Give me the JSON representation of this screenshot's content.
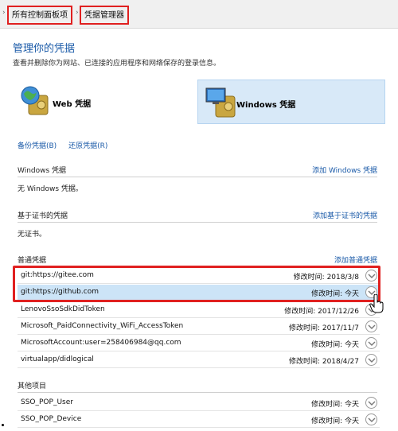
{
  "breadcrumb": {
    "items": [
      {
        "label": "所有控制面板项"
      },
      {
        "label": "凭据管理器"
      }
    ]
  },
  "page": {
    "title": "管理你的凭据",
    "description": "查看并删除你为网站、已连接的应用程序和网络保存的登录信息。"
  },
  "credential_types": [
    {
      "label": "Web 凭据",
      "icon": "globe-safe-icon",
      "selected": false
    },
    {
      "label": "Windows 凭据",
      "icon": "computer-safe-icon",
      "selected": true
    }
  ],
  "actions": {
    "backup": "备份凭据(B)",
    "restore": "还原凭据(R)"
  },
  "sections": {
    "windows": {
      "title": "Windows 凭据",
      "link": "添加 Windows 凭据",
      "empty": "无 Windows 凭据。"
    },
    "cert": {
      "title": "基于证书的凭据",
      "link": "添加基于证书的凭据",
      "empty": "无证书。"
    },
    "generic": {
      "title": "普通凭据",
      "link": "添加普通凭据",
      "items": [
        {
          "name": "git:https://gitee.com",
          "date": "修改时间:  2018/3/8"
        },
        {
          "name": "git:https://github.com",
          "date": "修改时间:  今天"
        },
        {
          "name": "LenovoSsoSdkDidToken",
          "date": "修改时间:  2017/12/26"
        },
        {
          "name": "Microsoft_PaidConnectivity_WiFi_AccessToken",
          "date": "修改时间:  2017/11/7"
        },
        {
          "name": "MicrosoftAccount:user=258406984@qq.com",
          "date": "修改时间:  今天"
        },
        {
          "name": "virtualapp/didlogical",
          "date": "修改时间:  2018/4/27"
        }
      ]
    },
    "other": {
      "title": "其他项目",
      "items": [
        {
          "name": "SSO_POP_User",
          "date": "修改时间:  今天"
        },
        {
          "name": "SSO_POP_Device",
          "date": "修改时间:  今天"
        }
      ]
    }
  },
  "colors": {
    "accent": "#1a5aa8",
    "highlight": "#e02020",
    "selected_row": "#cce4f7"
  }
}
